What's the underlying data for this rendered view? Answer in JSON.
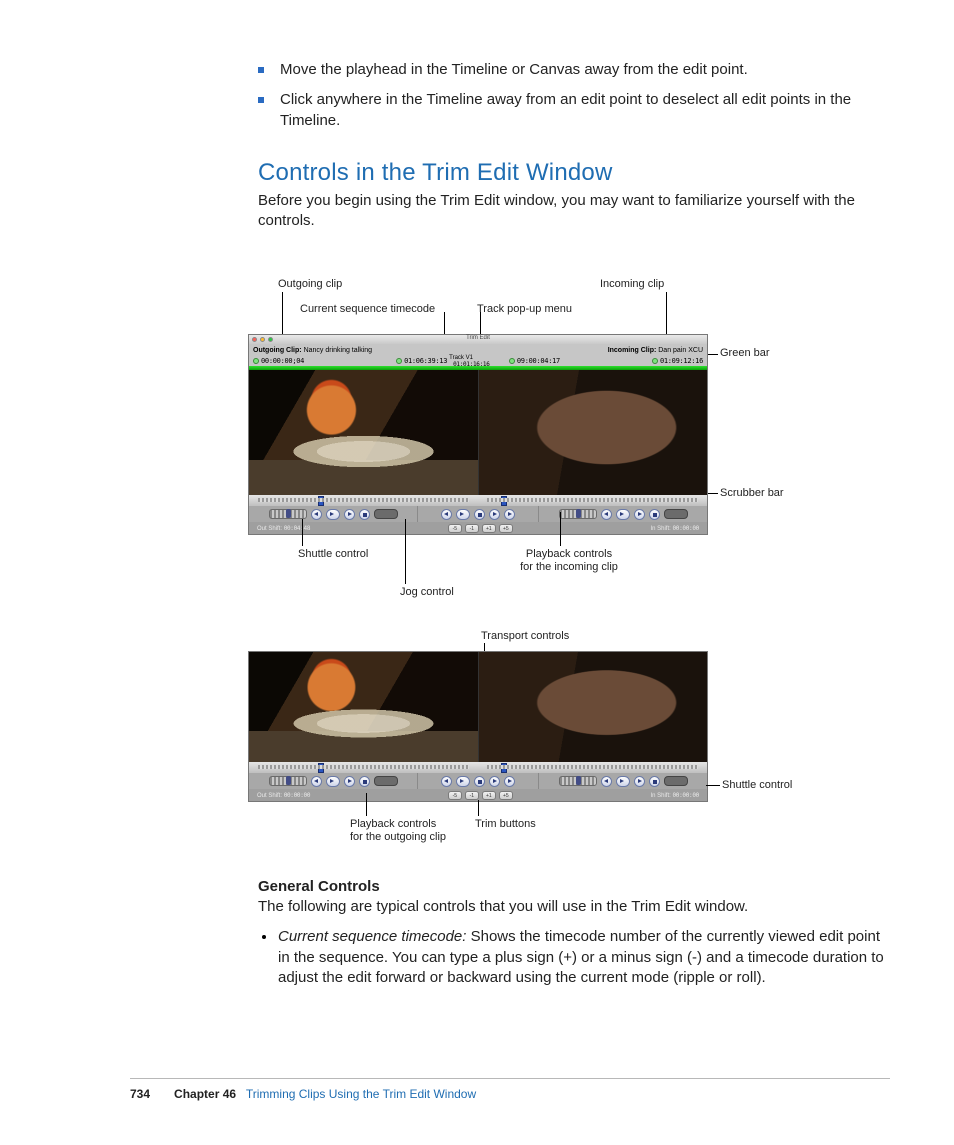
{
  "bullets": [
    "Move the playhead in the Timeline or Canvas away from the edit point.",
    "Click anywhere in the Timeline away from an edit point to deselect all edit points in the Timeline."
  ],
  "section_heading": "Controls in the Trim Edit Window",
  "section_intro": "Before you begin using the Trim Edit window, you may want to familiarize yourself with the controls.",
  "labels": {
    "outgoing_clip": "Outgoing clip",
    "current_seq_tc": "Current sequence timecode",
    "track_popup": "Track pop-up menu",
    "incoming_clip": "Incoming clip",
    "green_bar": "Green bar",
    "scrubber_bar": "Scrubber bar",
    "shuttle_control": "Shuttle control",
    "jog_control": "Jog control",
    "playback_incoming_l1": "Playback controls",
    "playback_incoming_l2": "for the incoming clip",
    "transport_controls": "Transport controls",
    "playback_outgoing_l1": "Playback controls",
    "playback_outgoing_l2": "for the outgoing clip",
    "trim_buttons": "Trim buttons"
  },
  "trim_window": {
    "title_center": "Trim Edit",
    "outgoing_label": "Outgoing Clip:",
    "outgoing_name": "Nancy drinking talking",
    "incoming_label": "Incoming Clip:",
    "incoming_name": "Dan pain XCU",
    "tc_left": "00:00:00;04",
    "tc_out": "01:06:39:13",
    "tc_center": "01:01:16:16",
    "tc_in": "09:00:04:17",
    "tc_right": "01:09:12:16",
    "track_label": "Track V1",
    "foot_left_label": "Out Shift:",
    "foot_left_tc": "00:04:48",
    "foot_right_label": "In Shift:",
    "foot_right_tc": "00:00:00",
    "foot_left2_tc": "00:00:00",
    "foot_right2_tc": "00:00:00",
    "trim_minus5": "-5",
    "trim_minus1": "-1",
    "trim_plus1": "+1",
    "trim_plus5": "+5"
  },
  "general_heading": "General Controls",
  "general_intro": "The following are typical controls that you will use in the Trim Edit window.",
  "def_term": "Current sequence timecode:",
  "def_body": "  Shows the timecode number of the currently viewed edit point in the sequence. You can type a plus sign (+) or a minus sign (-) and a timecode duration to adjust the edit forward or backward using the current mode (ripple or roll).",
  "footer": {
    "page": "734",
    "chapter_label": "Chapter 46",
    "chapter_title": "Trimming Clips Using the Trim Edit Window"
  }
}
